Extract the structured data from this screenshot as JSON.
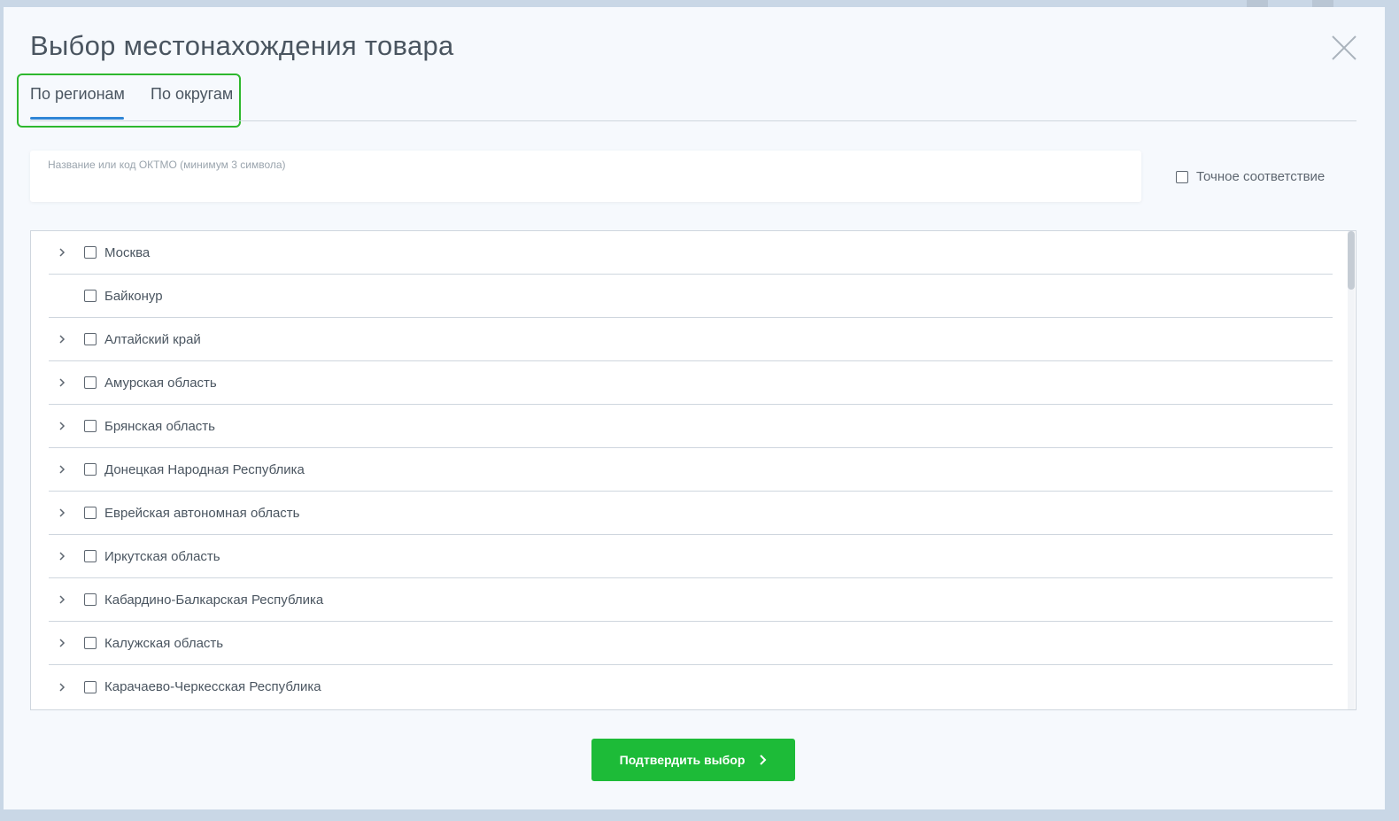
{
  "modal": {
    "title": "Выбор местонахождения товара",
    "close_icon": "close-icon"
  },
  "tabs": [
    {
      "label": "По регионам",
      "active": true
    },
    {
      "label": "По округам",
      "active": false
    }
  ],
  "search": {
    "label": "Название или код ОКТМО (минимум 3 символа)",
    "value": "",
    "exact_match_label": "Точное соответствие",
    "exact_match_checked": false
  },
  "regions": [
    {
      "label": "Москва",
      "expandable": true,
      "checked": false
    },
    {
      "label": "Байконур",
      "expandable": false,
      "checked": false
    },
    {
      "label": "Алтайский край",
      "expandable": true,
      "checked": false
    },
    {
      "label": "Амурская область",
      "expandable": true,
      "checked": false
    },
    {
      "label": "Брянская область",
      "expandable": true,
      "checked": false
    },
    {
      "label": "Донецкая Народная Республика",
      "expandable": true,
      "checked": false
    },
    {
      "label": "Еврейская автономная область",
      "expandable": true,
      "checked": false
    },
    {
      "label": "Иркутская область",
      "expandable": true,
      "checked": false
    },
    {
      "label": "Кабардино-Балкарская Республика",
      "expandable": true,
      "checked": false
    },
    {
      "label": "Калужская область",
      "expandable": true,
      "checked": false
    },
    {
      "label": "Карачаево-Черкесская Республика",
      "expandable": true,
      "checked": false
    }
  ],
  "confirm": {
    "label": "Подтвердить выбор",
    "icon": "chevron-right-icon"
  },
  "colors": {
    "accent_blue": "#2f86d6",
    "confirm_green": "#1dbb38",
    "highlight_green": "#2eb82e"
  }
}
